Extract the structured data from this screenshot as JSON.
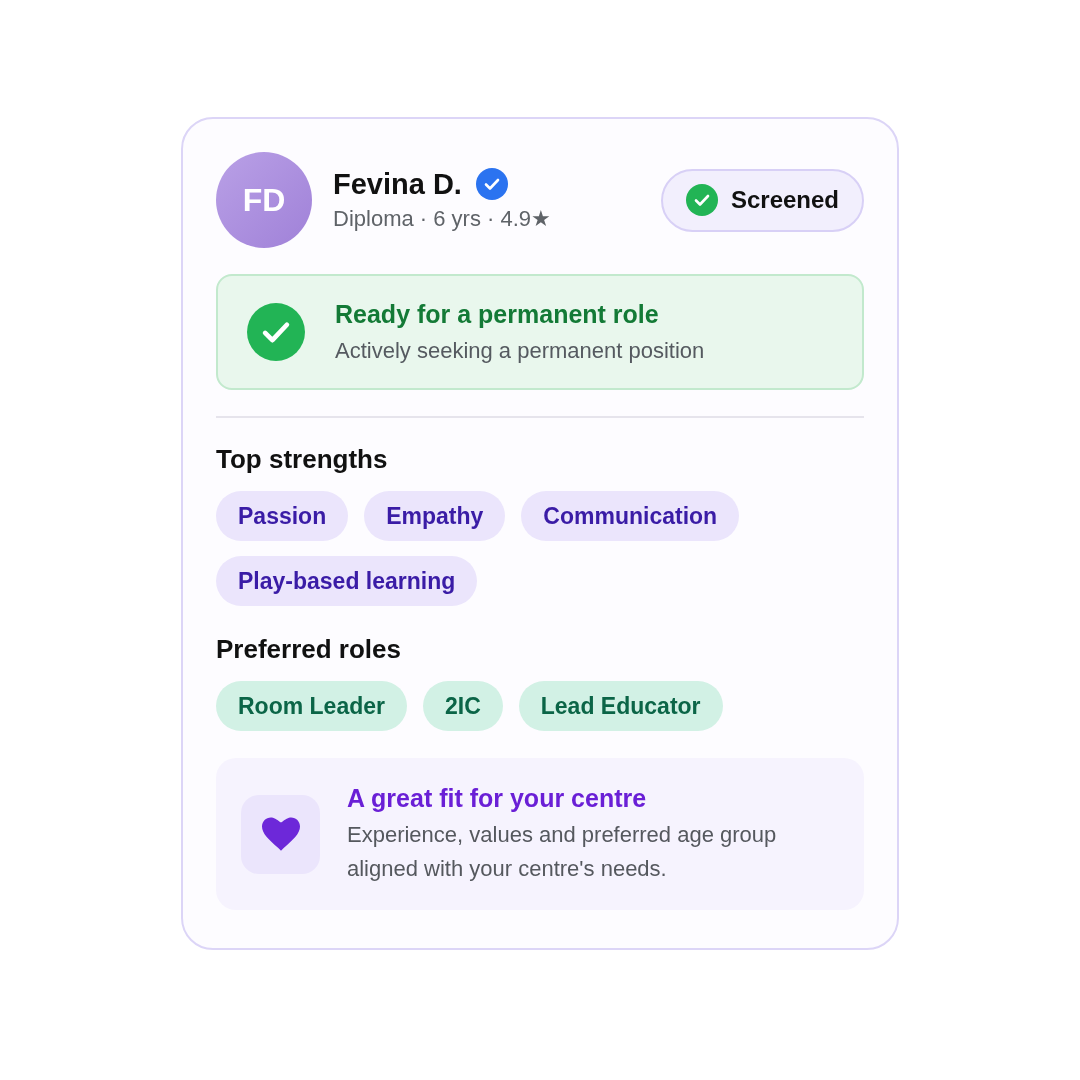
{
  "candidate": {
    "initials": "FD",
    "name": "Fevina D.",
    "verified": true,
    "meta": "Diploma · 6 yrs · 4.9★"
  },
  "status_badge": {
    "label": "Screened"
  },
  "availability": {
    "title": "Ready for a permanent role",
    "subtitle": "Actively seeking a permanent position"
  },
  "sections": [
    {
      "kind": "strengths",
      "title": "Top strengths",
      "tags": [
        "Passion",
        "Empathy",
        "Communication",
        "Play-based learning"
      ]
    },
    {
      "kind": "roles",
      "title": "Preferred roles",
      "tags": [
        "Room Leader",
        "2IC",
        "Lead Educator"
      ]
    }
  ],
  "fit_note": {
    "title": "A great fit for your centre",
    "body": "Experience, values and preferred age group aligned with your centre's needs."
  }
}
